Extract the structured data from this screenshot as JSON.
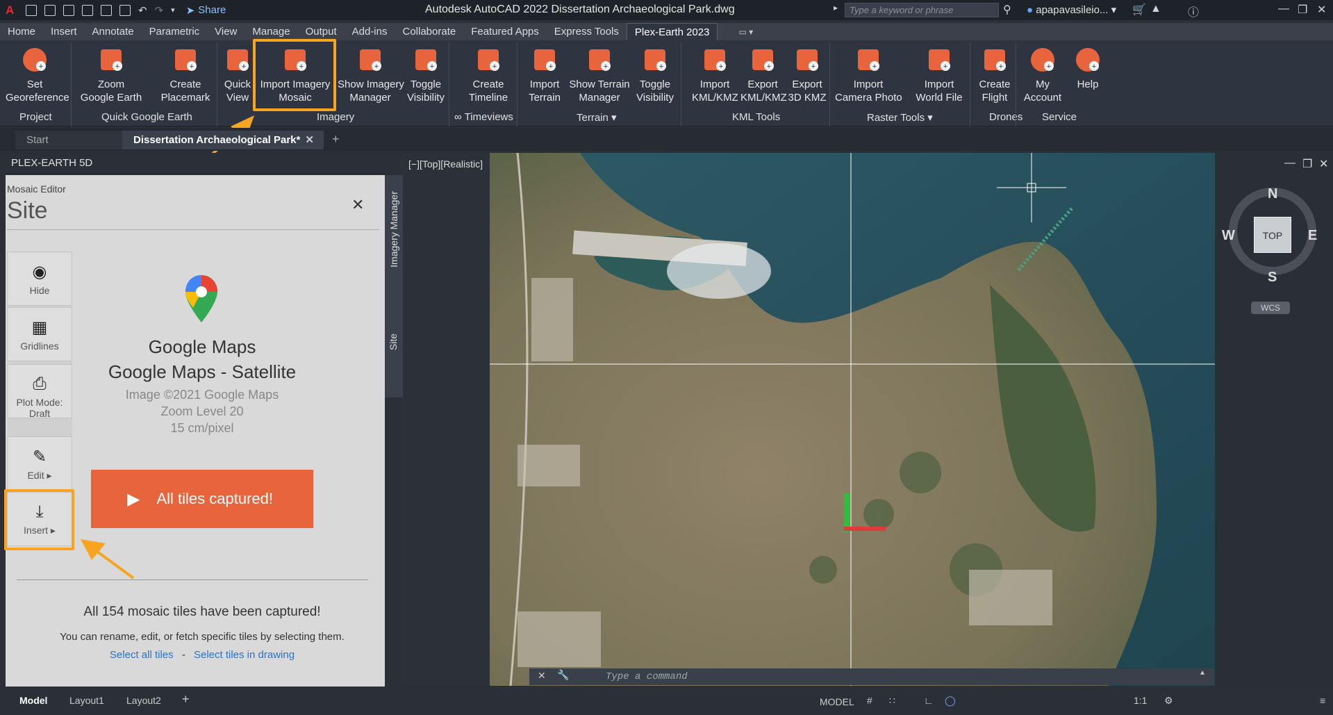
{
  "titlebar": {
    "share": "Share",
    "app_title": "Autodesk AutoCAD 2022   Dissertation Archaeological Park.dwg",
    "search_placeholder": "Type a keyword or phrase",
    "user": "apapavasileio..."
  },
  "menu": [
    "Home",
    "Insert",
    "Annotate",
    "Parametric",
    "View",
    "Manage",
    "Output",
    "Add-ins",
    "Collaborate",
    "Featured Apps",
    "Express Tools",
    "Plex-Earth 2023"
  ],
  "ribbon": {
    "buttons": [
      {
        "l1": "Set",
        "l2": "Georeference",
        "icon": "georeference-icon"
      },
      {
        "l1": "Zoom",
        "l2": "Google Earth",
        "icon": "zoom-google-earth-icon"
      },
      {
        "l1": "Create",
        "l2": "Placemark",
        "icon": "placemark-icon"
      },
      {
        "l1": "Quick",
        "l2": "View",
        "icon": "quick-view-icon"
      },
      {
        "l1": "Import Imagery",
        "l2": "Mosaic",
        "icon": "import-mosaic-icon"
      },
      {
        "l1": "Show Imagery",
        "l2": "Manager",
        "icon": "imagery-manager-icon"
      },
      {
        "l1": "Toggle",
        "l2": "Visibility",
        "icon": "toggle-visibility-icon"
      },
      {
        "l1": "Create",
        "l2": "Timeline",
        "icon": "timeline-icon"
      },
      {
        "l1": "Import",
        "l2": "Terrain",
        "icon": "import-terrain-icon"
      },
      {
        "l1": "Show Terrain",
        "l2": "Manager",
        "icon": "terrain-manager-icon"
      },
      {
        "l1": "Toggle",
        "l2": "Visibility",
        "icon": "terrain-visibility-icon"
      },
      {
        "l1": "Import",
        "l2": "KML/KMZ",
        "icon": "import-kml-icon"
      },
      {
        "l1": "Export",
        "l2": "KML/KMZ",
        "icon": "export-kml-icon"
      },
      {
        "l1": "Export",
        "l2": "3D KMZ",
        "icon": "export-3d-kmz-icon"
      },
      {
        "l1": "Import",
        "l2": "Camera Photo",
        "icon": "camera-photo-icon"
      },
      {
        "l1": "Import",
        "l2": "World File",
        "icon": "world-file-icon"
      },
      {
        "l1": "Create",
        "l2": "Flight",
        "icon": "drone-icon"
      },
      {
        "l1": "My",
        "l2": "Account",
        "icon": "account-icon"
      },
      {
        "l1": "Help",
        "l2": "",
        "icon": "help-icon"
      }
    ],
    "panels": [
      "Project",
      "Quick Google Earth",
      "Imagery",
      "∞ Timeviews",
      "Terrain ▾",
      "KML Tools",
      "Raster Tools ▾",
      "Drones",
      "Service"
    ]
  },
  "tabs": {
    "start": "Start",
    "doc": "Dissertation Archaeological Park*"
  },
  "palette": {
    "title": "PLEX-EARTH 5D",
    "subtitle": "Mosaic Editor",
    "heading": "Site",
    "tools": [
      {
        "label": "Hide",
        "icon": "eye-icon"
      },
      {
        "label": "Gridlines",
        "icon": "grid-icon"
      },
      {
        "label": "Plot Mode: Draft",
        "icon": "printer-icon"
      },
      {
        "label": "Edit ▸",
        "icon": "pencil-icon"
      },
      {
        "label": "Insert ▸",
        "icon": "download-icon"
      }
    ],
    "provider": "Google Maps",
    "layer": "Google Maps - Satellite",
    "copyright": "Image ©2021 Google Maps",
    "zoom": "Zoom Level 20",
    "resolution": "15 cm/pixel",
    "capture_button": "All tiles captured!",
    "status_title": "All 154 mosaic tiles have been captured!",
    "status_text": "You can rename, edit, or fetch specific tiles by selecting them.",
    "select_all": "Select all tiles",
    "dash": "-",
    "select_drawing": "Select tiles in drawing",
    "side_tab_1": "Imagery Manager",
    "side_tab_2": "Site"
  },
  "viewport": {
    "label": "[−][Top][Realistic]",
    "compass": {
      "n": "N",
      "s": "S",
      "e": "E",
      "w": "W",
      "top": "TOP",
      "wcs": "WCS"
    },
    "command_placeholder": "Type a command"
  },
  "status": {
    "model": "Model",
    "layout1": "Layout1",
    "layout2": "Layout2",
    "plus": "+",
    "model_btn": "MODEL",
    "scale": "1:1"
  },
  "colors": {
    "accent": "#e8643c",
    "highlight": "#f7a520",
    "link": "#2a73c9"
  }
}
